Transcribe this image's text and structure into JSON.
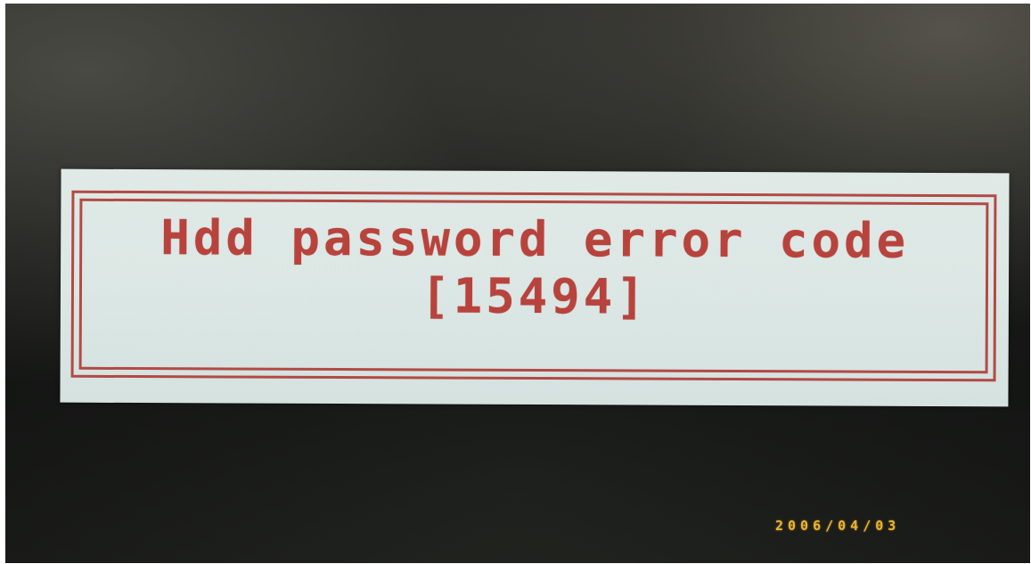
{
  "dialog": {
    "title": "Hdd password error code",
    "code": "[15494]"
  },
  "camera": {
    "date_stamp": "2006/04/03"
  },
  "colors": {
    "screen_background": "#1e201d",
    "dialog_background": "#dbe7e4",
    "dialog_border": "#b24a45",
    "dialog_text": "#b8433d",
    "date_stamp": "#e8b530"
  }
}
